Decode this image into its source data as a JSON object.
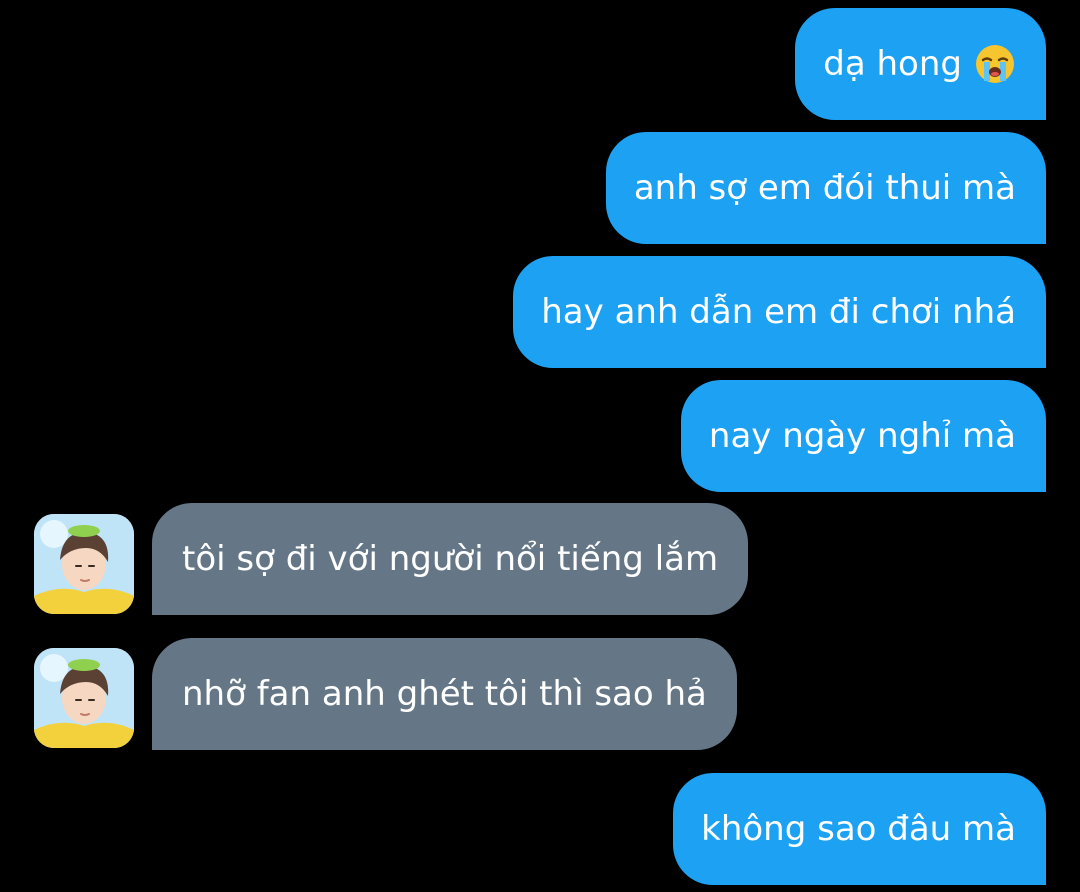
{
  "conversation": {
    "messages": [
      {
        "side": "sent",
        "text": "dạ hong",
        "emoji": "loudly-crying-face"
      },
      {
        "side": "sent",
        "text": "anh sợ em đói thui mà"
      },
      {
        "side": "sent",
        "text": "hay anh dẫn em đi chơi nhá"
      },
      {
        "side": "sent",
        "text": "nay ngày nghỉ mà"
      },
      {
        "side": "received",
        "text": "tôi sợ đi với người nổi tiếng lắm",
        "avatar": "contact-avatar"
      },
      {
        "side": "received",
        "text": "nhỡ fan anh ghét tôi thì sao hả",
        "avatar": "contact-avatar"
      },
      {
        "side": "sent",
        "text": "không sao đâu mà"
      }
    ]
  },
  "colors": {
    "background": "#000000",
    "sent_bubble": "#1da1f2",
    "received_bubble": "#657786",
    "text": "#ffffff"
  }
}
